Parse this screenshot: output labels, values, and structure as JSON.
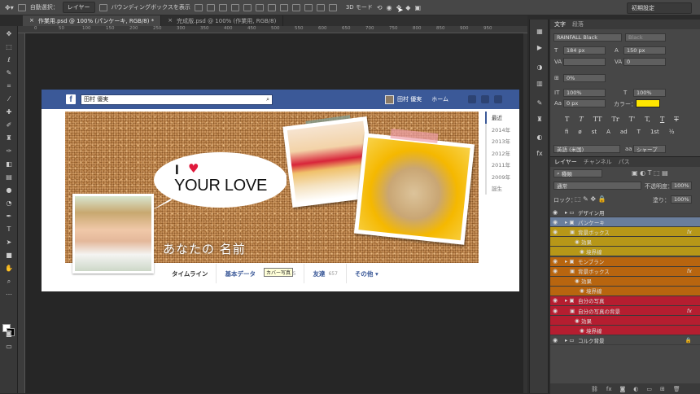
{
  "options_bar": {
    "auto_select_label": "自動選択：",
    "auto_select_value": "レイヤー",
    "bounding_box_label": "バウンディングボックスを表示",
    "mode_3d": "3D モード",
    "workspace": "初期設定"
  },
  "tabs": [
    {
      "label": "作業用.psd @ 100% (パンケーキ, RGB/8) *",
      "close": "×"
    },
    {
      "label": "完成版.psd @ 100% (作業用, RGB/8)",
      "close": "×"
    }
  ],
  "rulers": [
    "0",
    "50",
    "100",
    "150",
    "200",
    "250",
    "300",
    "350",
    "400",
    "450",
    "500",
    "550",
    "600",
    "650",
    "700",
    "750",
    "800",
    "850",
    "900",
    "950"
  ],
  "facebook": {
    "logo": "f",
    "search_value": "田村 優実",
    "user_name": "田村 優実",
    "home": "ホーム",
    "bubble_i": "I",
    "bubble_love": "YOUR LOVE",
    "profile_name": "あなたの 名前",
    "years": [
      "最近",
      "2014年",
      "2013年",
      "2012年",
      "2011年",
      "2009年",
      "誕生"
    ],
    "nav": [
      {
        "label": "タイムライン",
        "count": ""
      },
      {
        "label": "基本データ",
        "count": "175"
      },
      {
        "label": "友達",
        "count": "657"
      },
      {
        "label": "その他 ▾",
        "count": ""
      }
    ],
    "tooltip": "カバー写真"
  },
  "character_panel": {
    "tabs": [
      "文字",
      "段落"
    ],
    "font_family": "RAINFALL Black",
    "font_style": "Black",
    "font_size": "184 px",
    "leading": "150 px",
    "tracking": "0",
    "scale_v_percent": "0%",
    "scale_v": "100%",
    "scale_h": "100%",
    "baseline": "0 px",
    "color_label": "カラー：",
    "color": "#ffe600",
    "language": "英語 (米国)",
    "antialias": "シャープ",
    "glyphs_row1": [
      "T",
      "T",
      "TT",
      "Tr",
      "T'",
      "T,",
      "T",
      "T"
    ],
    "glyphs_row2": [
      "fi",
      "ø",
      "st",
      "A",
      "ad",
      "T",
      "1st",
      "½"
    ]
  },
  "layers_panel": {
    "tabs": [
      "レイヤー",
      "チャンネル",
      "パス"
    ],
    "filter_label": "種類",
    "blend_mode": "通常",
    "opacity_label": "不透明度：",
    "opacity": "100%",
    "lock_label": "ロック：",
    "fill_label": "塗り：",
    "fill": "100%",
    "layers": [
      {
        "name": "デザイン用",
        "type": "group",
        "color": "none",
        "fx": ""
      },
      {
        "name": "パンケーキ",
        "type": "smart",
        "color": "sel",
        "fx": ""
      },
      {
        "name": "背景ボックス",
        "type": "layer",
        "color": "yel",
        "fx": "fx"
      },
      {
        "name": "効果",
        "type": "effect",
        "color": "yel",
        "fx": ""
      },
      {
        "name": "境界線",
        "type": "effect",
        "color": "yel",
        "fx": ""
      },
      {
        "name": "モンブラン",
        "type": "smart",
        "color": "or",
        "fx": ""
      },
      {
        "name": "背景ボックス",
        "type": "layer",
        "color": "or",
        "fx": "fx"
      },
      {
        "name": "効果",
        "type": "effect",
        "color": "or",
        "fx": ""
      },
      {
        "name": "境界線",
        "type": "effect",
        "color": "or",
        "fx": ""
      },
      {
        "name": "自分の写真",
        "type": "smart",
        "color": "red",
        "fx": ""
      },
      {
        "name": "自分の写真の背景",
        "type": "layer",
        "color": "red",
        "fx": "fx"
      },
      {
        "name": "効果",
        "type": "effect",
        "color": "red",
        "fx": ""
      },
      {
        "name": "境界線",
        "type": "effect",
        "color": "red",
        "fx": ""
      },
      {
        "name": "コルク背景",
        "type": "group",
        "color": "none",
        "fx": ""
      }
    ]
  }
}
